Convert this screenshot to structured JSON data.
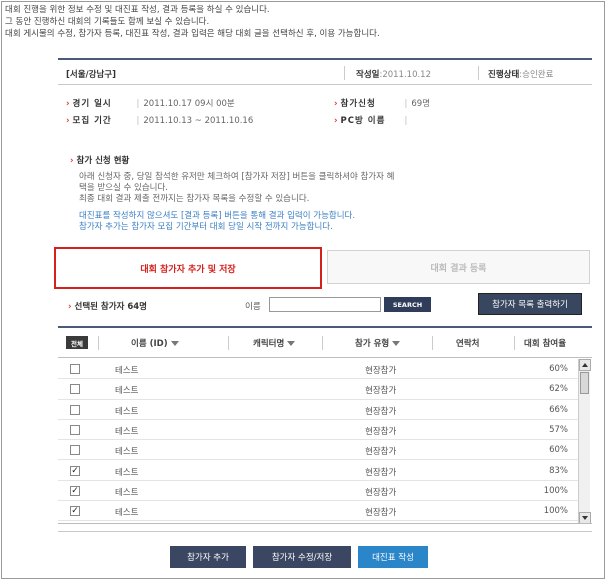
{
  "intro": {
    "line1": "대회 진행을 위한 정보 수정 및 대진표 작성, 결과 등록을 하실 수 있습니다.",
    "line2": "그 동안 진행하신 대회의 기록들도 함께 보실 수 있습니다.",
    "line3": "대회 게시물의 수정, 참가자 등록, 대진표 작성, 결과 입력은 해당 대회 글을 선택하신 후, 이용 가능합니다."
  },
  "header": {
    "region": "[서울/강남구]",
    "created_label": "작성일",
    "created_value": ":2011.10.12",
    "status_label": "진행상태",
    "status_value": ":승인완료"
  },
  "info": {
    "game_date_label": "경기 일시",
    "game_date_value": "2011.10.17 09시 00분",
    "recruit_label": "모집 기간",
    "recruit_value": "2011.10.13 ~ 2011.10.16",
    "applicants_label": "참가신청",
    "applicants_value": "69명",
    "pc_room_label": "PC방 이름"
  },
  "section": {
    "title": "참가 신청 현황",
    "guide1": "아래 신청자 중, 당일 참석한 유저만 체크하여 [참가자 저장] 버튼을 클릭하셔야 참가자 혜",
    "guide2": "택을 받으실 수 있습니다.",
    "guide3": "최종 대회 결과 제출 전까지는 참가자 목록을 수정할 수 있습니다.",
    "blue1": "대진표를 작성하지 않으셔도 [결과 등록] 버튼을 통해 결과 입력이 가능합니다.",
    "blue2": "참가자 추가는 참가자 모집 기간부터 대회 당일 시작 전까지 가능합니다."
  },
  "tabs": {
    "active": "대회 참가자 추가 및 저장",
    "inactive": "대회 결과 등록"
  },
  "toolbar": {
    "selected_label": "선택된 참가자 64명",
    "search_label": "이름",
    "search_value": "",
    "search_button": "SEARCH",
    "print_button": "참가자 목록 출력하기"
  },
  "table": {
    "all_label": "전체",
    "columns": [
      "이름 (ID)",
      "캐릭터명",
      "참가 유형",
      "연락처",
      "대회 참여율"
    ],
    "rows": [
      {
        "checked": false,
        "name": "테스트",
        "type": "현장참가",
        "rate": "60%"
      },
      {
        "checked": false,
        "name": "테스트",
        "type": "현장참가",
        "rate": "62%"
      },
      {
        "checked": false,
        "name": "테스트",
        "type": "현장참가",
        "rate": "66%"
      },
      {
        "checked": false,
        "name": "테스트",
        "type": "현장참가",
        "rate": "57%"
      },
      {
        "checked": false,
        "name": "테스트",
        "type": "현장참가",
        "rate": "60%"
      },
      {
        "checked": true,
        "name": "테스트",
        "type": "현장참가",
        "rate": "83%"
      },
      {
        "checked": true,
        "name": "테스트",
        "type": "현장참가",
        "rate": "100%"
      },
      {
        "checked": true,
        "name": "테스트",
        "type": "현장참가",
        "rate": "100%"
      }
    ]
  },
  "footer": {
    "add_button": "참가자 추가",
    "save_button": "참가자 수정/저장",
    "bracket_button": "대진표 작성"
  },
  "colors": {
    "accent_red": "#d6201c",
    "navy": "#3a4662",
    "blue": "#2a86c8"
  }
}
